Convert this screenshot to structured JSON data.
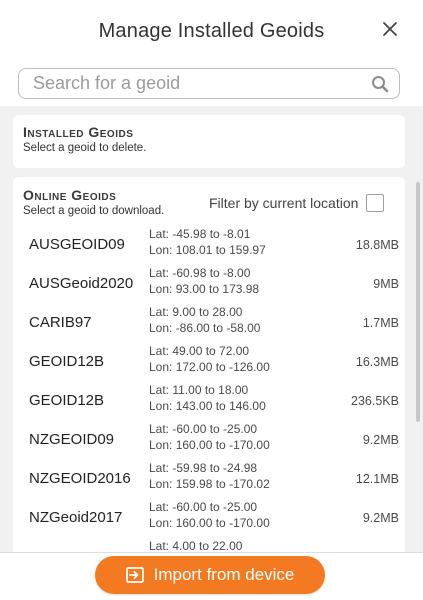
{
  "dialog": {
    "title": "Manage Installed Geoids",
    "close_icon": "close-icon"
  },
  "search": {
    "placeholder": "Search for a geoid",
    "value": "",
    "icon": "search-icon"
  },
  "installed": {
    "title": "Installed Geoids",
    "subtitle": "Select a geoid to delete."
  },
  "online": {
    "title": "Online Geoids",
    "subtitle": "Select a geoid to download.",
    "filter_label": "Filter by current location",
    "filter_checked": false,
    "items": [
      {
        "name": "AUSGEOID09",
        "lat": "Lat: -45.98 to -8.01",
        "lon": "Lon: 108.01 to 159.97",
        "size": "18.8MB"
      },
      {
        "name": "AUSGeoid2020",
        "lat": "Lat: -60.98 to -8.00",
        "lon": "Lon: 93.00 to 173.98",
        "size": "9MB"
      },
      {
        "name": "CARIB97",
        "lat": "Lat: 9.00 to 28.00",
        "lon": "Lon: -86.00 to -58.00",
        "size": "1.7MB"
      },
      {
        "name": "GEOID12B",
        "lat": "Lat: 49.00 to 72.00",
        "lon": "Lon: 172.00 to -126.00",
        "size": "16.3MB"
      },
      {
        "name": "GEOID12B",
        "lat": "Lat: 11.00 to 18.00",
        "lon": "Lon: 143.00 to 146.00",
        "size": "236.5KB"
      },
      {
        "name": "NZGEOID09",
        "lat": "Lat: -60.00 to -25.00",
        "lon": "Lon: 160.00 to -170.00",
        "size": "9.2MB"
      },
      {
        "name": "NZGEOID2016",
        "lat": "Lat: -59.98 to -24.98",
        "lon": "Lon: 159.98 to -170.02",
        "size": "12.1MB"
      },
      {
        "name": "NZGeoid2017",
        "lat": "Lat: -60.00 to -25.00",
        "lon": "Lon: 160.00 to -170.00",
        "size": "9.2MB"
      },
      {
        "name": "",
        "lat": "Lat: 4.00 to 22.00",
        "lon": "",
        "size": ""
      }
    ]
  },
  "footer": {
    "import_label": "Import from device",
    "import_icon": "import-icon"
  },
  "colors": {
    "accent": "#f37a21",
    "panel_background": "#f1f1f1"
  }
}
